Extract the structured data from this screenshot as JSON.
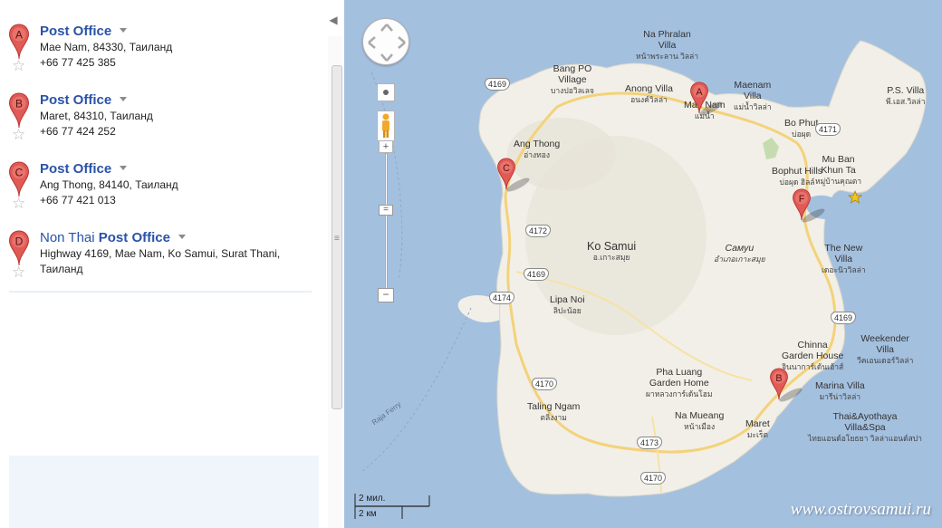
{
  "panel": {
    "results": [
      {
        "letter": "A",
        "prefix": "",
        "title": "Post Office",
        "line1": "Mae Nam, 84330, Таиланд",
        "line2": "+66 77 425 385"
      },
      {
        "letter": "B",
        "prefix": "",
        "title": "Post Office",
        "line1": "Maret, 84310, Таиланд",
        "line2": "+66 77 424 252"
      },
      {
        "letter": "C",
        "prefix": "",
        "title": "Post Office",
        "line1": "Ang Thong, 84140, Таиланд",
        "line2": "+66 77 421 013"
      },
      {
        "letter": "D",
        "prefix": "Non Thai",
        "title": "Post Office",
        "line1": "Highway 4169, Mae Nam, Ko Samui, Surat Thani,",
        "line2": "Таиланд"
      }
    ]
  },
  "map": {
    "places": [
      {
        "name": "Na Phralan Villa",
        "l1": "Na Phralan",
        "l2": "Villa",
        "th": "หน้าพระลาน วิลล่า"
      },
      {
        "name": "Bang PO Village",
        "l1": "Bang PO",
        "l2": "Village",
        "th": "บางปอวิลเลจ"
      },
      {
        "name": "Anong Villa",
        "l1": "Anong Villa",
        "th": "อนงค์วิลล่า"
      },
      {
        "name": "Maenam Villa",
        "l1": "Maenam",
        "l2": "Villa",
        "th": "แม่น้ำวิลล่า"
      },
      {
        "name": "Mae Nam",
        "l1": "Mae Nam",
        "th": "แม่น้ำ"
      },
      {
        "name": "P.S. Villa",
        "l1": "P.S. Villa",
        "th": "พี.เอส.วิลล่า"
      },
      {
        "name": "Bo Phut",
        "l1": "Bo Phut",
        "th": "บ่อผุด"
      },
      {
        "name": "Ang Thong",
        "l1": "Ang Thong",
        "th": "อ่างทอง"
      },
      {
        "name": "Bophut Hills",
        "l1": "Bophut Hills",
        "th": "บ่อผุด ฮิลล์"
      },
      {
        "name": "Mu Ban Khun Ta",
        "l1": "Mu Ban",
        "l2": "Khun Ta",
        "th": "หมู่บ้านคุณตา"
      },
      {
        "name": "Ko Samui",
        "l1": "Ko Samui",
        "th": "อ.เกาะสมุย"
      },
      {
        "name": "Samui",
        "l1": "Самуи",
        "th": "อำเภอเกาะสมุย"
      },
      {
        "name": "The New Villa",
        "l1": "The New",
        "l2": "Villa",
        "th": "เดอะนิววิลล่า"
      },
      {
        "name": "Lipa Noi",
        "l1": "Lipa Noi",
        "th": "ลิปะน้อย"
      },
      {
        "name": "Weekender Villa",
        "l1": "Weekender",
        "l2": "Villa",
        "th": "วีคเอนเดอร์วิลล่า"
      },
      {
        "name": "Chinna Garden House",
        "l1": "Chinna",
        "l2": "Garden House",
        "th": "จินนาการ์เด้นเฮ้าส์"
      },
      {
        "name": "Marina Villa",
        "l1": "Marina Villa",
        "th": "มารีน่าวิลล่า"
      },
      {
        "name": "Pha Luang Garden Home",
        "l1": "Pha Luang",
        "l2": "Garden Home",
        "th": "ผาหลวงการ์เด้นโฮม"
      },
      {
        "name": "Taling Ngam",
        "l1": "Taling Ngam",
        "th": "ตลิ่งงาม"
      },
      {
        "name": "Na Mueang",
        "l1": "Na Mueang",
        "th": "หน้าเมือง"
      },
      {
        "name": "Maret",
        "l1": "Maret",
        "th": "มะเร็ต"
      },
      {
        "name": "Thai&Ayothaya Villa&Spa",
        "l1": "Thai&Ayothaya",
        "l2": "Villa&Spa",
        "th": "ไทยแอนด์อโยธยา วิลล่าแอนด์สปา"
      }
    ],
    "roads": [
      "4169",
      "4171",
      "4172",
      "4169",
      "4174",
      "4169",
      "4170",
      "4173",
      "4170"
    ],
    "sea_label": "Raja Ferry",
    "markers": [
      "A",
      "B",
      "C",
      "F"
    ],
    "scale": {
      "miles": "2 мил.",
      "km": "2 км"
    },
    "watermark": "www.ostrovsamui.ru"
  },
  "colors": {
    "sea": "#a4c0df",
    "land": "#f1efe7",
    "road": "#fbe49a",
    "marker": "#e15a55",
    "link": "#2a52a8"
  },
  "icons": [
    "marker-icon",
    "star-icon",
    "pan-control-icon",
    "pegman-icon",
    "zoom-plus-icon",
    "zoom-minus-icon",
    "map-star-icon"
  ]
}
